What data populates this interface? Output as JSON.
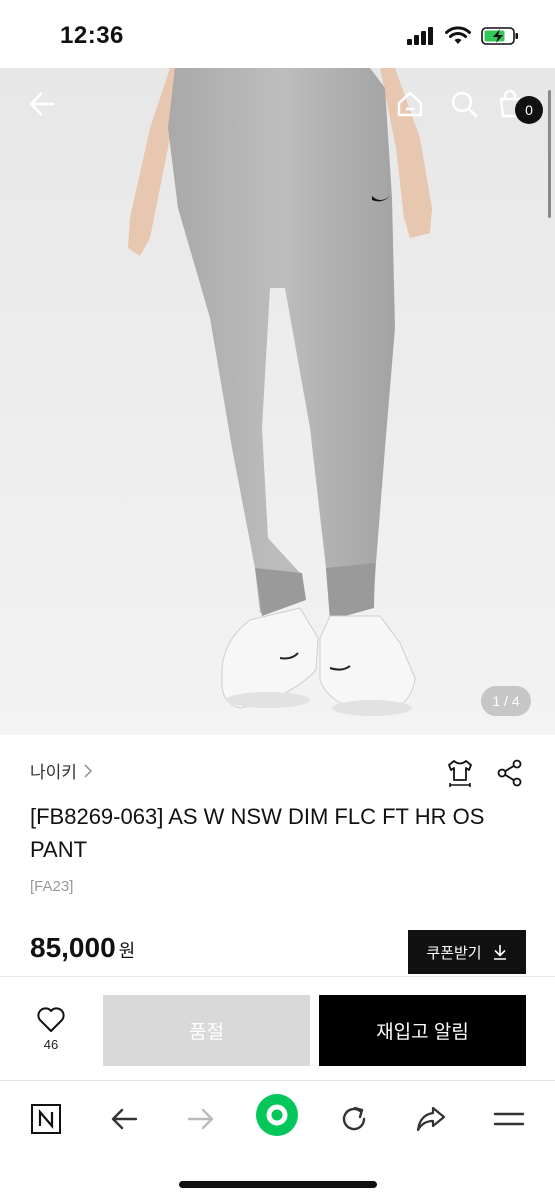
{
  "status_bar": {
    "time": "12:36"
  },
  "header": {
    "back_icon": "arrow-left-icon",
    "home_icon": "home-icon",
    "search_icon": "search-icon",
    "cart_icon": "shopping-bag-icon",
    "cart_count": "0"
  },
  "gallery": {
    "counter": "1 / 4",
    "current": 1,
    "total": 4
  },
  "product": {
    "brand": "나이키",
    "title": "[FB8269-063] AS W NSW DIM FLC FT HR OS PANT",
    "season": "[FA23]",
    "price": "85,000",
    "currency": "원",
    "coupon_label": "쿠폰받기"
  },
  "actions": {
    "like_count": "46",
    "soldout_label": "품절",
    "restock_label": "재입고 알림"
  },
  "browser_toolbar": {
    "items": [
      "naver-n-icon",
      "back-arrow-icon",
      "forward-arrow-icon",
      "green-home-circle-icon",
      "refresh-icon",
      "share-arrow-icon",
      "menu-icon"
    ],
    "accent": "#03c75a"
  }
}
